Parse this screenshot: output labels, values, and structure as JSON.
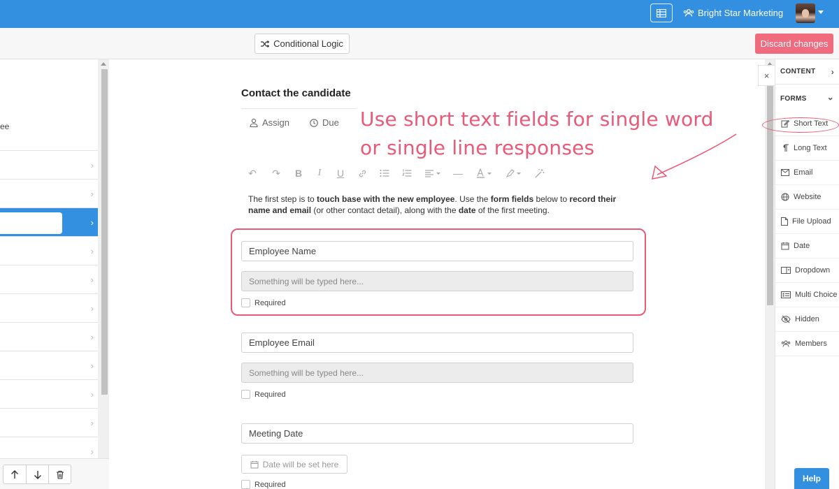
{
  "topbar": {
    "org_name": "Bright Star Marketing",
    "brand_color": "#3390e0",
    "icons": [
      "grid-view-icon",
      "users-icon",
      "avatar",
      "chevron-down-icon"
    ]
  },
  "toolbar": {
    "conditional_logic_label": "Conditional Logic",
    "discard_label": "Discard changes",
    "discard_color": "#f06b7d"
  },
  "left_panel": {
    "partial_text": "ee",
    "rows": [
      "",
      "",
      "",
      "",
      "",
      "",
      "",
      "",
      "",
      "",
      ""
    ],
    "active_row_index": 2,
    "bottom_actions": [
      "arrow-up-icon",
      "arrow-down-icon",
      "trash-icon"
    ]
  },
  "task": {
    "title": "Contact the candidate",
    "assign_label": "Assign",
    "due_label": "Due"
  },
  "annotation": {
    "line1": "Use short text fields for single word",
    "line2": "or single line responses",
    "color": "#ea5a78"
  },
  "editor_toolbar": [
    "undo-icon",
    "redo-icon",
    "bold-icon",
    "italic-icon",
    "underline-icon",
    "link-icon",
    "bullet-list-icon",
    "numbered-list-icon",
    "align-icon",
    "horizontal-rule-icon",
    "text-color-icon",
    "highlight-icon",
    "magic-wand-icon"
  ],
  "intro": {
    "p1": "The first step is to ",
    "b1": "touch base with the new employee",
    "p2": ". Use the ",
    "b2": "form fields",
    "p3": " below to ",
    "b3": "record their name and email",
    "p4": " (or other contact detail), along with the ",
    "b4": "date",
    "p5": " of the first meeting."
  },
  "fields": [
    {
      "label": "Employee Name",
      "preview": "Something will be typed here...",
      "required_label": "Required"
    },
    {
      "label": "Employee Email",
      "preview": "Something will be typed here...",
      "required_label": "Required"
    },
    {
      "label": "Meeting Date",
      "preview": "Date will be set here",
      "required_label": "Required"
    }
  ],
  "right_panel": {
    "content_heading": "CONTENT",
    "forms_heading": "FORMS",
    "items": [
      {
        "label": "Short Text",
        "icon": "edit-icon"
      },
      {
        "label": "Long Text",
        "icon": "paragraph-icon"
      },
      {
        "label": "Email",
        "icon": "envelope-icon"
      },
      {
        "label": "Website",
        "icon": "globe-icon"
      },
      {
        "label": "File Upload",
        "icon": "file-icon"
      },
      {
        "label": "Date",
        "icon": "calendar-icon"
      },
      {
        "label": "Dropdown",
        "icon": "dropdown-icon"
      },
      {
        "label": "Multi Choice",
        "icon": "multi-choice-icon"
      },
      {
        "label": "Hidden",
        "icon": "eye-slash-icon"
      },
      {
        "label": "Members",
        "icon": "users-icon"
      }
    ],
    "close_label": "×"
  },
  "help_label": "Help"
}
